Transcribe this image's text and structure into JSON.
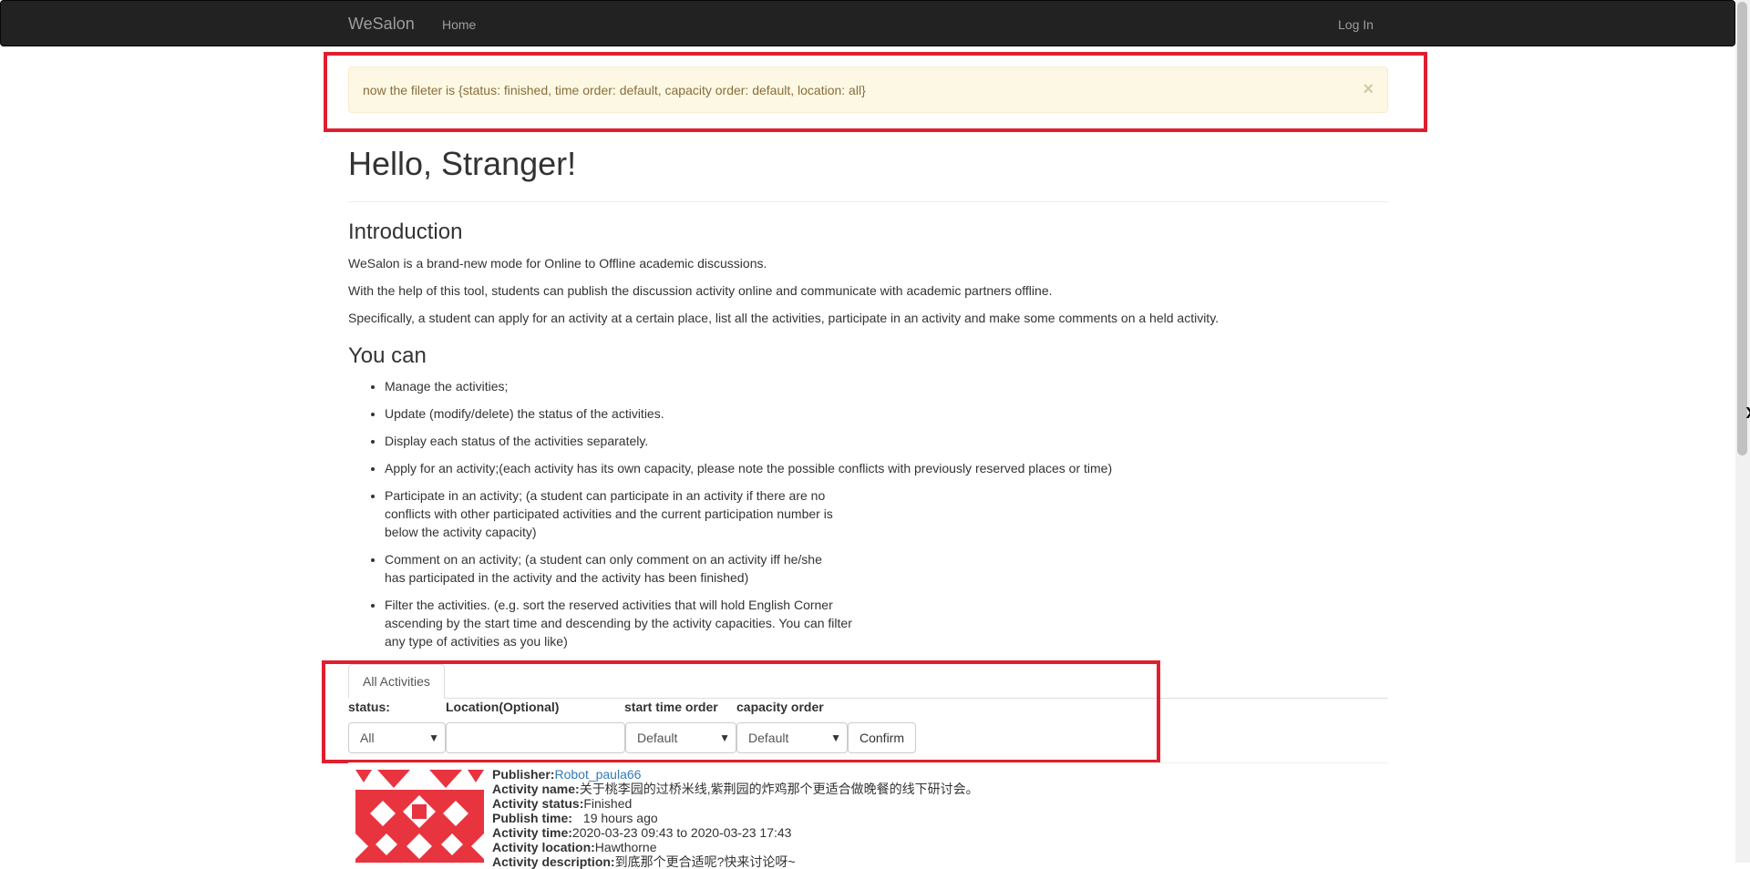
{
  "navbar": {
    "brand": "WeSalon",
    "home": "Home",
    "login": "Log In"
  },
  "alert": {
    "text": "now the fileter is {status: finished, time order: default, capacity order: default, location: all}",
    "close": "×"
  },
  "greeting": "Hello, Stranger!",
  "intro": {
    "heading": "Introduction",
    "paragraphs": [
      "WeSalon is a brand-new mode for Online to Offline academic discussions.",
      "With the help of this tool, students can publish the discussion activity online and communicate with academic partners offline.",
      "Specifically, a student can apply for an activity at a certain place, list all the activities, participate in an activity and make some comments on a held activity."
    ]
  },
  "youcan": {
    "heading": "You can",
    "items": [
      "Manage the activities;",
      "Update (modify/delete) the status of the activities.",
      "Display each status of the activities separately.",
      "Apply for an activity;(each activity has its own capacity, please note the possible conflicts with previously reserved places or time)",
      "Participate in an activity; (a student can participate in an activity if there are no conflicts with other participated activities and the current participation number is below the activity capacity)",
      "Comment on an activity; (a student can only comment on an activity iff he/she has participated in the activity and the activity has been finished)",
      "Filter the activities. (e.g. sort the reserved activities that will hold English Corner ascending by the start time and descending by the activity capacities. You can filter any type of activities as you like)"
    ]
  },
  "filter": {
    "tab": "All Activities",
    "status_label": "status:",
    "status_value": "All",
    "location_label": "Location(Optional)",
    "location_value": "",
    "time_label": "start time order",
    "time_value": "Default",
    "capacity_label": "capacity order",
    "capacity_value": "Default",
    "confirm": "Confirm"
  },
  "activity": {
    "publisher_label": "Publisher:",
    "publisher": "Robot_paula66",
    "name_label": "Activity name:",
    "name": "关于桃李园的过桥米线,紫荆园的炸鸡那个更适合做晚餐的线下研讨会。",
    "status_label": "Activity status:",
    "status": "Finished",
    "publish_label": "Publish time:",
    "publish": "19 hours ago",
    "time_label": "Activity time:",
    "time": "2020-03-23 09:43 to 2020-03-23 17:43",
    "location_label": "Activity location:",
    "location": "Hawthorne",
    "desc_label": "Activity description:",
    "desc": "到底那个更合适呢?快来讨论呀~"
  },
  "colors": {
    "navbar": "#222222",
    "alert_bg": "#fcf8e3",
    "alert_text": "#8a6d3b",
    "highlight": "#e01e2e",
    "avatar": "#e8343f",
    "link": "#337ab7"
  }
}
